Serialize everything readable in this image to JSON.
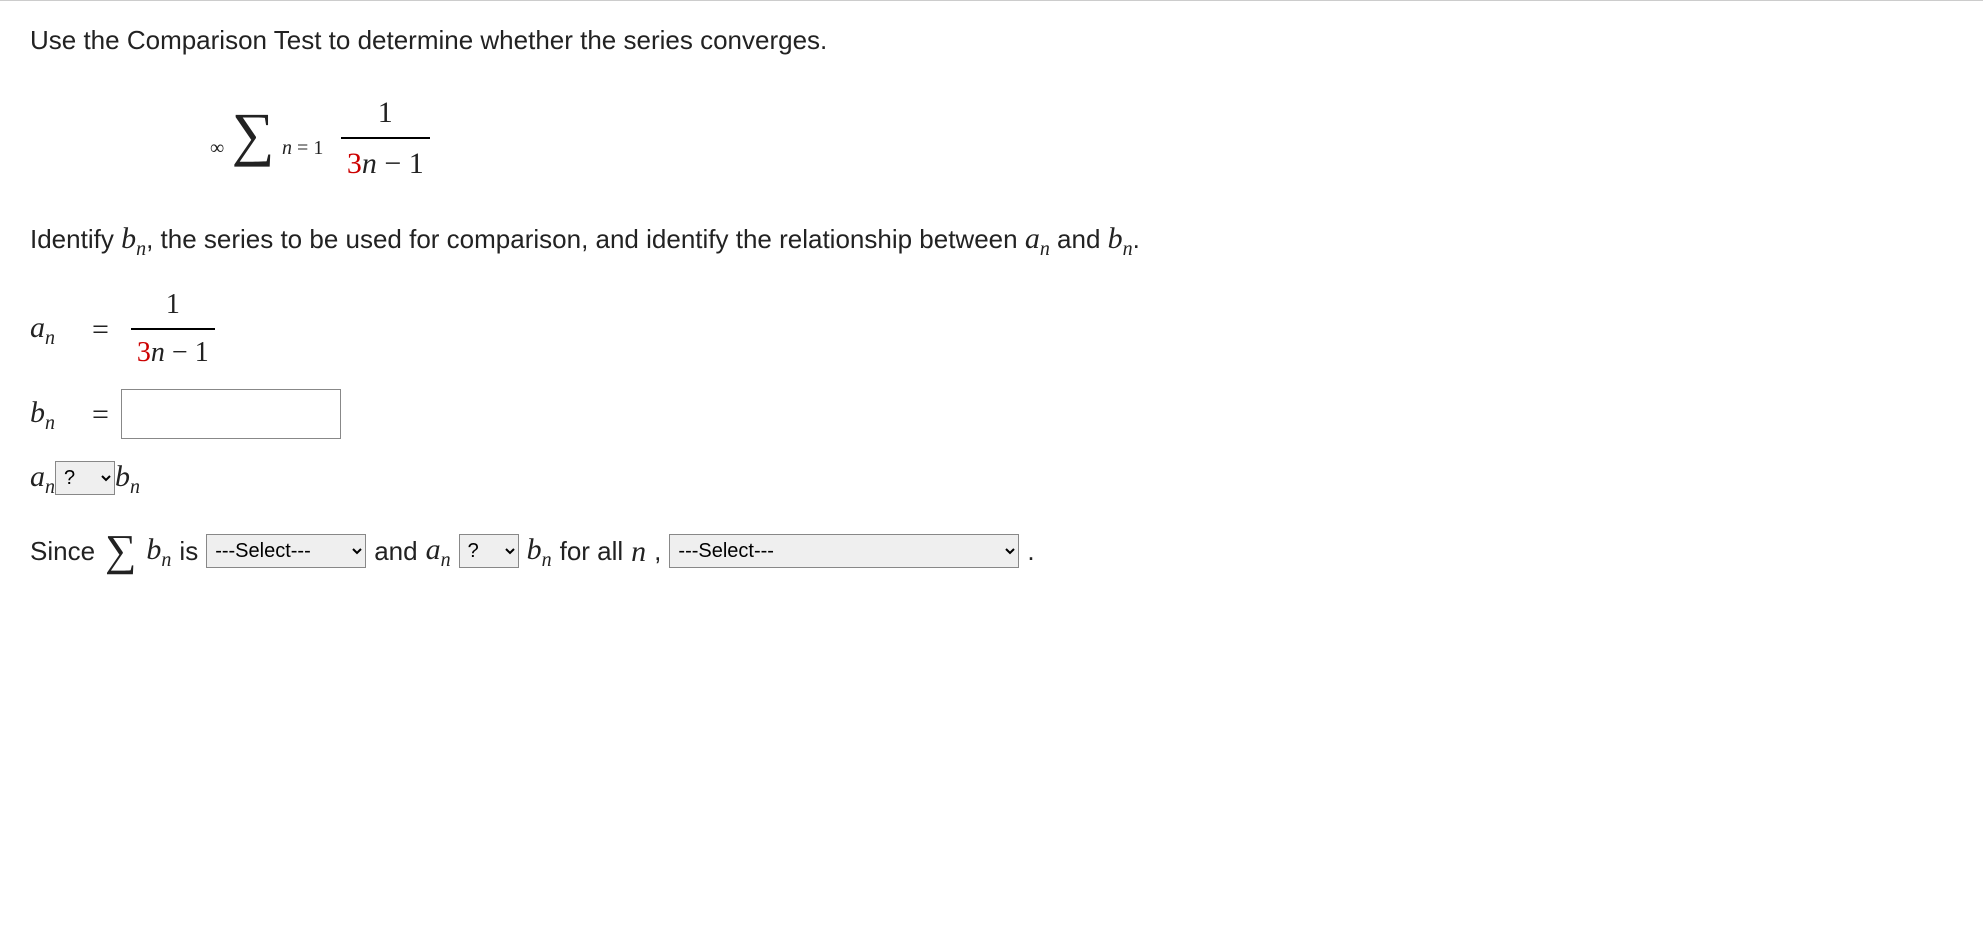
{
  "prompt": "Use the Comparison Test to determine whether the series converges.",
  "series": {
    "upper": "∞",
    "lower_n": "n",
    "lower_eq": " = 1",
    "numerator": "1",
    "denom_coeff": "3",
    "denom_var": "n",
    "denom_rest": " − 1"
  },
  "identify": {
    "t1": "Identify ",
    "bn": "b",
    "bn_sub": "n",
    "t2": ", the series to be used for comparison, and identify the relationship between ",
    "an": "a",
    "an_sub": "n",
    "t3": " and ",
    "bn2": "b",
    "bn2_sub": "n",
    "t4": "."
  },
  "an_def": {
    "label_a": "a",
    "label_sub": "n",
    "eq": "=",
    "num": "1",
    "den_coeff": "3",
    "den_var": "n",
    "den_rest": " − 1"
  },
  "bn_def": {
    "label_b": "b",
    "label_sub": "n",
    "eq": "=",
    "value": ""
  },
  "compare": {
    "a": "a",
    "a_sub": "n",
    "sel_placeholder": "?",
    "b": "b",
    "b_sub": "n"
  },
  "since": {
    "t1": "Since",
    "sigma": "∑",
    "b": "b",
    "b_sub": "n",
    "t2": "is",
    "sel1_placeholder": "---Select---",
    "t3": "and",
    "a": "a",
    "a_sub": "n",
    "sel2_placeholder": "?",
    "b2": "b",
    "b2_sub": "n",
    "t4": "for all",
    "nvar": "n",
    "comma": ",",
    "sel3_placeholder": "---Select---",
    "period": "."
  }
}
